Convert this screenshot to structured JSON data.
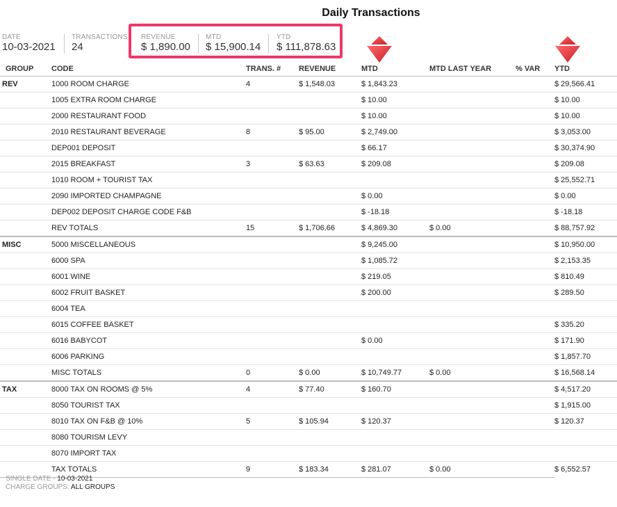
{
  "page": {
    "title": "Daily Transactions"
  },
  "summary": {
    "date": {
      "label": "DATE",
      "value": "10-03-2021"
    },
    "transactions": {
      "label": "TRANSACTIONS",
      "value": "24"
    },
    "revenue": {
      "label": "REVENUE",
      "value": "$ 1,890.00"
    },
    "mtd": {
      "label": "MTD",
      "value": "$ 15,900.14"
    },
    "ytd": {
      "label": "YTD",
      "value": "$ 111,878.63"
    }
  },
  "table": {
    "columns": [
      "GROUP",
      "CODE",
      "TRANS. #",
      "REVENUE",
      "MTD",
      "MTD LAST YEAR",
      "% VAR",
      "YTD"
    ],
    "rows": [
      [
        "REV",
        "1000 ROOM CHARGE",
        "4",
        "$ 1,548.03",
        "$ 1,843.23",
        "",
        "",
        "$ 29,566.41"
      ],
      [
        "",
        "1005 EXTRA ROOM CHARGE",
        "",
        "",
        "$ 10.00",
        "",
        "",
        "$ 10.00"
      ],
      [
        "",
        "2000 RESTAURANT FOOD",
        "",
        "",
        "$ 10.00",
        "",
        "",
        "$ 10.00"
      ],
      [
        "",
        "2010 RESTAURANT BEVERAGE",
        "8",
        "$ 95.00",
        "$ 2,749.00",
        "",
        "",
        "$ 3,053.00"
      ],
      [
        "",
        "DEP001 DEPOSIT",
        "",
        "",
        "$ 66.17",
        "",
        "",
        "$ 30,374.90"
      ],
      [
        "",
        "2015 BREAKFAST",
        "3",
        "$ 63.63",
        "$ 209.08",
        "",
        "",
        "$ 209.08"
      ],
      [
        "",
        "1010 ROOM + TOURIST TAX",
        "",
        "",
        "",
        "",
        "",
        "$ 25,552.71"
      ],
      [
        "",
        "2090 IMPORTED CHAMPAGNE",
        "",
        "",
        "$ 0.00",
        "",
        "",
        "$ 0.00"
      ],
      [
        "",
        "DEP002 DEPOSIT CHARGE CODE F&B",
        "",
        "",
        "$ -18.18",
        "",
        "",
        "$ -18.18"
      ],
      [
        "",
        "REV TOTALS",
        "15",
        "$ 1,706.66",
        "$ 4,869.30",
        "$ 0.00",
        "",
        "$ 88,757.92"
      ],
      [
        "MISC",
        "5000 MISCELLANEOUS",
        "",
        "",
        "$ 9,245.00",
        "",
        "",
        "$ 10,950.00"
      ],
      [
        "",
        "6000 SPA",
        "",
        "",
        "$ 1,085.72",
        "",
        "",
        "$ 2,153.35"
      ],
      [
        "",
        "6001 WINE",
        "",
        "",
        "$ 219.05",
        "",
        "",
        "$ 810.49"
      ],
      [
        "",
        "6002 FRUIT BASKET",
        "",
        "",
        "$ 200.00",
        "",
        "",
        "$ 289.50"
      ],
      [
        "",
        "6004 TEA",
        "",
        "",
        "",
        "",
        "",
        ""
      ],
      [
        "",
        "6015 COFFEE BASKET",
        "",
        "",
        "",
        "",
        "",
        "$ 335.20"
      ],
      [
        "",
        "6016 BABYCOT",
        "",
        "",
        "$ 0.00",
        "",
        "",
        "$ 171.90"
      ],
      [
        "",
        "6006 PARKING",
        "",
        "",
        "",
        "",
        "",
        "$ 1,857.70"
      ],
      [
        "",
        "MISC TOTALS",
        "0",
        "$ 0.00",
        "$ 10,749.77",
        "$ 0.00",
        "",
        "$ 16,568.14"
      ],
      [
        "TAX",
        "8000 TAX ON ROOMS @ 5%",
        "4",
        "$ 77.40",
        "$ 160.70",
        "",
        "",
        "$ 4,517.20"
      ],
      [
        "",
        "8050 TOURIST TAX",
        "",
        "",
        "",
        "",
        "",
        "$ 1,915.00"
      ],
      [
        "",
        "8010 TAX ON F&B @ 10%",
        "5",
        "$ 105.94",
        "$ 120.37",
        "",
        "",
        "$ 120.37"
      ],
      [
        "",
        "8080 TOURISM LEVY",
        "",
        "",
        "",
        "",
        "",
        ""
      ],
      [
        "",
        "8070 IMPORT TAX",
        "",
        "",
        "",
        "",
        "",
        ""
      ],
      [
        "",
        "TAX TOTALS",
        "9",
        "$ 183.34",
        "$ 281.07",
        "$ 0.00",
        "",
        "$ 6,552.57"
      ]
    ]
  },
  "footer": {
    "single_date_label": "SINGLE DATE",
    "single_date_sep": " - ",
    "single_date_value": "10-03-2021",
    "charge_groups_label": "CHARGE GROUPS:",
    "charge_groups_value": " ALL GROUPS"
  },
  "colors": {
    "highlight": "#ef3768",
    "arrow": "#e8303c"
  },
  "icons": {
    "mtd_marker": "red-down-arrow-icon",
    "ytd_marker": "red-down-arrow-icon"
  }
}
